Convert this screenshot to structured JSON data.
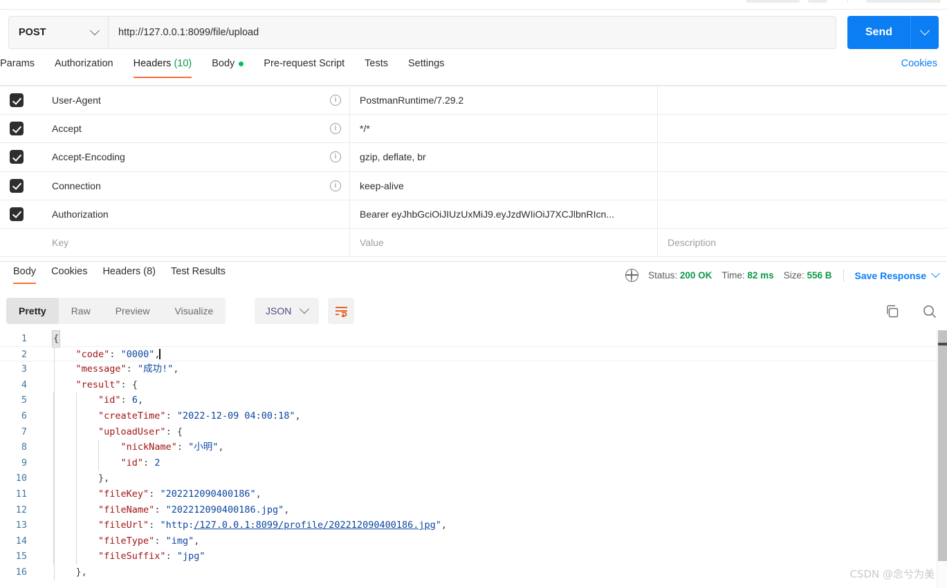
{
  "request": {
    "method": "POST",
    "url": "http://127.0.0.1:8099/file/upload",
    "send_label": "Send",
    "tabs": [
      {
        "label": "Params",
        "active": false
      },
      {
        "label": "Authorization",
        "active": false
      },
      {
        "label": "Headers",
        "count": "(10)",
        "active": true
      },
      {
        "label": "Body",
        "dot": true,
        "active": false
      },
      {
        "label": "Pre-request Script",
        "active": false
      },
      {
        "label": "Tests",
        "active": false
      },
      {
        "label": "Settings",
        "active": false
      }
    ],
    "cookies_link": "Cookies"
  },
  "headers_table": {
    "placeholder_key": "Key",
    "placeholder_value": "Value",
    "placeholder_description": "Description",
    "rows": [
      {
        "checked": true,
        "key": "User-Agent",
        "value": "PostmanRuntime/7.29.2",
        "info": true,
        "description": ""
      },
      {
        "checked": true,
        "key": "Accept",
        "value": "*/*",
        "info": true,
        "description": ""
      },
      {
        "checked": true,
        "key": "Accept-Encoding",
        "value": "gzip, deflate, br",
        "info": true,
        "description": ""
      },
      {
        "checked": true,
        "key": "Connection",
        "value": "keep-alive",
        "info": true,
        "description": ""
      },
      {
        "checked": true,
        "key": "Authorization",
        "value": "Bearer  eyJhbGciOiJIUzUxMiJ9.eyJzdWIiOiJ7XCJlbnRIcn...",
        "info": false,
        "description": ""
      }
    ]
  },
  "response": {
    "tabs": [
      {
        "label": "Body",
        "active": true
      },
      {
        "label": "Cookies",
        "active": false
      },
      {
        "label": "Headers (8)",
        "active": false
      },
      {
        "label": "Test Results",
        "active": false
      }
    ],
    "status_label": "Status:",
    "status_value": "200 OK",
    "time_label": "Time:",
    "time_value": "82 ms",
    "size_label": "Size:",
    "size_value": "556 B",
    "save_response": "Save Response",
    "view_modes": [
      {
        "label": "Pretty",
        "active": true
      },
      {
        "label": "Raw",
        "active": false
      },
      {
        "label": "Preview",
        "active": false
      },
      {
        "label": "Visualize",
        "active": false
      }
    ],
    "format": "JSON"
  },
  "body_json": {
    "lines": [
      {
        "num": "1",
        "indent": 0,
        "active": false,
        "tokens": [
          {
            "t": "bracketopen",
            "v": "{"
          }
        ]
      },
      {
        "num": "2",
        "indent": 1,
        "active": true,
        "tokens": [
          {
            "t": "k",
            "v": "\"code\""
          },
          {
            "t": "p",
            "v": ": "
          },
          {
            "t": "s",
            "v": "\"0000\""
          },
          {
            "t": "p",
            "v": ","
          },
          {
            "t": "caret",
            "v": ""
          }
        ]
      },
      {
        "num": "3",
        "indent": 1,
        "active": false,
        "tokens": [
          {
            "t": "k",
            "v": "\"message\""
          },
          {
            "t": "p",
            "v": ": "
          },
          {
            "t": "s",
            "v": "\"成功!\""
          },
          {
            "t": "p",
            "v": ","
          }
        ]
      },
      {
        "num": "4",
        "indent": 1,
        "active": false,
        "tokens": [
          {
            "t": "k",
            "v": "\"result\""
          },
          {
            "t": "p",
            "v": ": "
          },
          {
            "t": "br",
            "v": "{"
          }
        ]
      },
      {
        "num": "5",
        "indent": 2,
        "active": false,
        "tokens": [
          {
            "t": "k",
            "v": "\"id\""
          },
          {
            "t": "p",
            "v": ": "
          },
          {
            "t": "n",
            "v": "6"
          },
          {
            "t": "p",
            "v": ","
          }
        ]
      },
      {
        "num": "6",
        "indent": 2,
        "active": false,
        "tokens": [
          {
            "t": "k",
            "v": "\"createTime\""
          },
          {
            "t": "p",
            "v": ": "
          },
          {
            "t": "s",
            "v": "\"2022-12-09 04:00:18\""
          },
          {
            "t": "p",
            "v": ","
          }
        ]
      },
      {
        "num": "7",
        "indent": 2,
        "active": false,
        "tokens": [
          {
            "t": "k",
            "v": "\"uploadUser\""
          },
          {
            "t": "p",
            "v": ": "
          },
          {
            "t": "br",
            "v": "{"
          }
        ]
      },
      {
        "num": "8",
        "indent": 3,
        "active": false,
        "tokens": [
          {
            "t": "k",
            "v": "\"nickName\""
          },
          {
            "t": "p",
            "v": ": "
          },
          {
            "t": "s",
            "v": "\"小明\""
          },
          {
            "t": "p",
            "v": ","
          }
        ]
      },
      {
        "num": "9",
        "indent": 3,
        "active": false,
        "tokens": [
          {
            "t": "k",
            "v": "\"id\""
          },
          {
            "t": "p",
            "v": ": "
          },
          {
            "t": "n",
            "v": "2"
          }
        ]
      },
      {
        "num": "10",
        "indent": 2,
        "active": false,
        "tokens": [
          {
            "t": "br",
            "v": "}"
          },
          {
            "t": "p",
            "v": ","
          }
        ]
      },
      {
        "num": "11",
        "indent": 2,
        "active": false,
        "tokens": [
          {
            "t": "k",
            "v": "\"fileKey\""
          },
          {
            "t": "p",
            "v": ": "
          },
          {
            "t": "s",
            "v": "\"202212090400186\""
          },
          {
            "t": "p",
            "v": ","
          }
        ]
      },
      {
        "num": "12",
        "indent": 2,
        "active": false,
        "tokens": [
          {
            "t": "k",
            "v": "\"fileName\""
          },
          {
            "t": "p",
            "v": ": "
          },
          {
            "t": "s",
            "v": "\"202212090400186.jpg\""
          },
          {
            "t": "p",
            "v": ","
          }
        ]
      },
      {
        "num": "13",
        "indent": 2,
        "active": false,
        "tokens": [
          {
            "t": "k",
            "v": "\"fileUrl\""
          },
          {
            "t": "p",
            "v": ": "
          },
          {
            "t": "s",
            "v": "\"http:"
          },
          {
            "t": "lnk",
            "v": "/127.0.0.1:8099/profile/202212090400186.jpg"
          },
          {
            "t": "s",
            "v": "\""
          },
          {
            "t": "p",
            "v": ","
          }
        ]
      },
      {
        "num": "14",
        "indent": 2,
        "active": false,
        "tokens": [
          {
            "t": "k",
            "v": "\"fileType\""
          },
          {
            "t": "p",
            "v": ": "
          },
          {
            "t": "s",
            "v": "\"img\""
          },
          {
            "t": "p",
            "v": ","
          }
        ]
      },
      {
        "num": "15",
        "indent": 2,
        "active": false,
        "tokens": [
          {
            "t": "k",
            "v": "\"fileSuffix\""
          },
          {
            "t": "p",
            "v": ": "
          },
          {
            "t": "s",
            "v": "\"jpg\""
          }
        ]
      },
      {
        "num": "16",
        "indent": 1,
        "active": false,
        "tokens": [
          {
            "t": "br",
            "v": "}"
          },
          {
            "t": "p",
            "v": ","
          }
        ]
      }
    ]
  },
  "watermark": "CSDN @念兮为美",
  "colors": {
    "accent_orange": "#ff6c37",
    "link_blue": "#0b7ef4",
    "status_green": "#0b9a46",
    "send_blue": "#0b7ef4"
  }
}
